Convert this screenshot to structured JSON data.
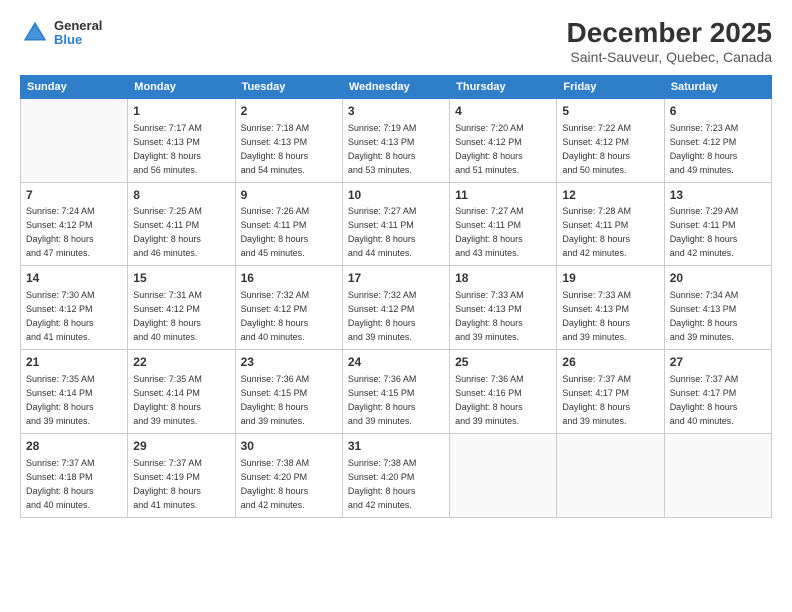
{
  "logo": {
    "general": "General",
    "blue": "Blue"
  },
  "header": {
    "month": "December 2025",
    "location": "Saint-Sauveur, Quebec, Canada"
  },
  "days_of_week": [
    "Sunday",
    "Monday",
    "Tuesday",
    "Wednesday",
    "Thursday",
    "Friday",
    "Saturday"
  ],
  "weeks": [
    [
      {
        "day": "",
        "info": ""
      },
      {
        "day": "1",
        "info": "Sunrise: 7:17 AM\nSunset: 4:13 PM\nDaylight: 8 hours\nand 56 minutes."
      },
      {
        "day": "2",
        "info": "Sunrise: 7:18 AM\nSunset: 4:13 PM\nDaylight: 8 hours\nand 54 minutes."
      },
      {
        "day": "3",
        "info": "Sunrise: 7:19 AM\nSunset: 4:13 PM\nDaylight: 8 hours\nand 53 minutes."
      },
      {
        "day": "4",
        "info": "Sunrise: 7:20 AM\nSunset: 4:12 PM\nDaylight: 8 hours\nand 51 minutes."
      },
      {
        "day": "5",
        "info": "Sunrise: 7:22 AM\nSunset: 4:12 PM\nDaylight: 8 hours\nand 50 minutes."
      },
      {
        "day": "6",
        "info": "Sunrise: 7:23 AM\nSunset: 4:12 PM\nDaylight: 8 hours\nand 49 minutes."
      }
    ],
    [
      {
        "day": "7",
        "info": "Sunrise: 7:24 AM\nSunset: 4:12 PM\nDaylight: 8 hours\nand 47 minutes."
      },
      {
        "day": "8",
        "info": "Sunrise: 7:25 AM\nSunset: 4:11 PM\nDaylight: 8 hours\nand 46 minutes."
      },
      {
        "day": "9",
        "info": "Sunrise: 7:26 AM\nSunset: 4:11 PM\nDaylight: 8 hours\nand 45 minutes."
      },
      {
        "day": "10",
        "info": "Sunrise: 7:27 AM\nSunset: 4:11 PM\nDaylight: 8 hours\nand 44 minutes."
      },
      {
        "day": "11",
        "info": "Sunrise: 7:27 AM\nSunset: 4:11 PM\nDaylight: 8 hours\nand 43 minutes."
      },
      {
        "day": "12",
        "info": "Sunrise: 7:28 AM\nSunset: 4:11 PM\nDaylight: 8 hours\nand 42 minutes."
      },
      {
        "day": "13",
        "info": "Sunrise: 7:29 AM\nSunset: 4:11 PM\nDaylight: 8 hours\nand 42 minutes."
      }
    ],
    [
      {
        "day": "14",
        "info": "Sunrise: 7:30 AM\nSunset: 4:12 PM\nDaylight: 8 hours\nand 41 minutes."
      },
      {
        "day": "15",
        "info": "Sunrise: 7:31 AM\nSunset: 4:12 PM\nDaylight: 8 hours\nand 40 minutes."
      },
      {
        "day": "16",
        "info": "Sunrise: 7:32 AM\nSunset: 4:12 PM\nDaylight: 8 hours\nand 40 minutes."
      },
      {
        "day": "17",
        "info": "Sunrise: 7:32 AM\nSunset: 4:12 PM\nDaylight: 8 hours\nand 39 minutes."
      },
      {
        "day": "18",
        "info": "Sunrise: 7:33 AM\nSunset: 4:13 PM\nDaylight: 8 hours\nand 39 minutes."
      },
      {
        "day": "19",
        "info": "Sunrise: 7:33 AM\nSunset: 4:13 PM\nDaylight: 8 hours\nand 39 minutes."
      },
      {
        "day": "20",
        "info": "Sunrise: 7:34 AM\nSunset: 4:13 PM\nDaylight: 8 hours\nand 39 minutes."
      }
    ],
    [
      {
        "day": "21",
        "info": "Sunrise: 7:35 AM\nSunset: 4:14 PM\nDaylight: 8 hours\nand 39 minutes."
      },
      {
        "day": "22",
        "info": "Sunrise: 7:35 AM\nSunset: 4:14 PM\nDaylight: 8 hours\nand 39 minutes."
      },
      {
        "day": "23",
        "info": "Sunrise: 7:36 AM\nSunset: 4:15 PM\nDaylight: 8 hours\nand 39 minutes."
      },
      {
        "day": "24",
        "info": "Sunrise: 7:36 AM\nSunset: 4:15 PM\nDaylight: 8 hours\nand 39 minutes."
      },
      {
        "day": "25",
        "info": "Sunrise: 7:36 AM\nSunset: 4:16 PM\nDaylight: 8 hours\nand 39 minutes."
      },
      {
        "day": "26",
        "info": "Sunrise: 7:37 AM\nSunset: 4:17 PM\nDaylight: 8 hours\nand 39 minutes."
      },
      {
        "day": "27",
        "info": "Sunrise: 7:37 AM\nSunset: 4:17 PM\nDaylight: 8 hours\nand 40 minutes."
      }
    ],
    [
      {
        "day": "28",
        "info": "Sunrise: 7:37 AM\nSunset: 4:18 PM\nDaylight: 8 hours\nand 40 minutes."
      },
      {
        "day": "29",
        "info": "Sunrise: 7:37 AM\nSunset: 4:19 PM\nDaylight: 8 hours\nand 41 minutes."
      },
      {
        "day": "30",
        "info": "Sunrise: 7:38 AM\nSunset: 4:20 PM\nDaylight: 8 hours\nand 42 minutes."
      },
      {
        "day": "31",
        "info": "Sunrise: 7:38 AM\nSunset: 4:20 PM\nDaylight: 8 hours\nand 42 minutes."
      },
      {
        "day": "",
        "info": ""
      },
      {
        "day": "",
        "info": ""
      },
      {
        "day": "",
        "info": ""
      }
    ]
  ]
}
